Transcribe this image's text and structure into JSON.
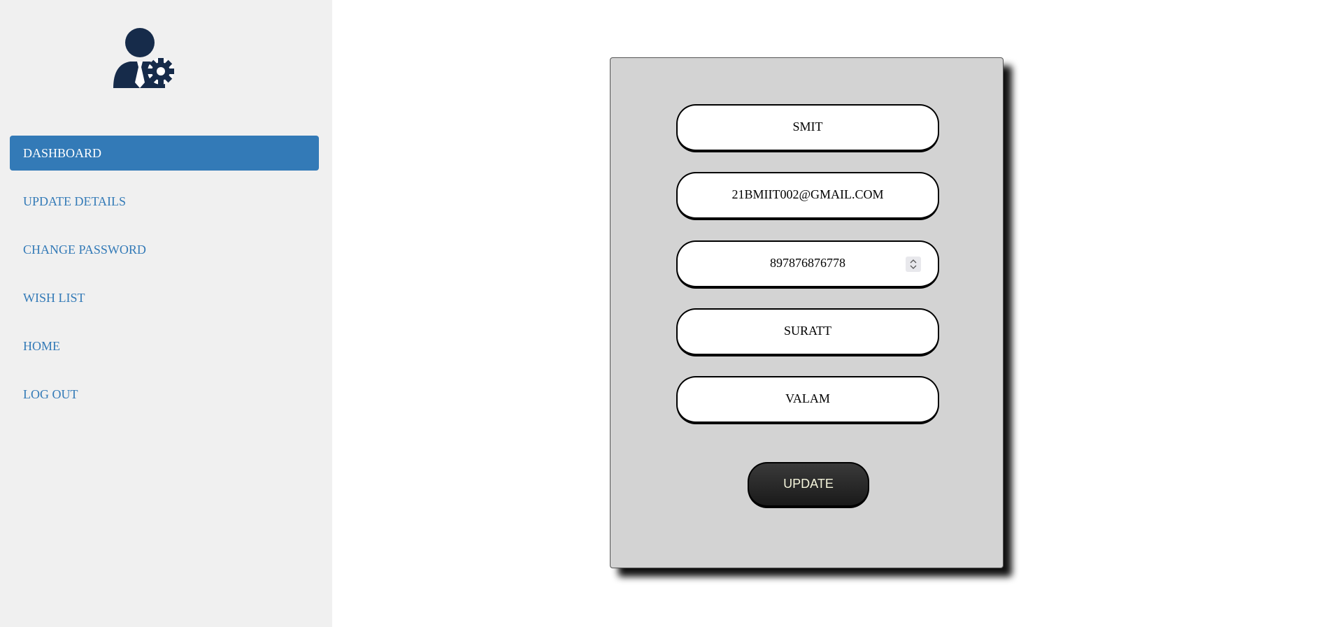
{
  "sidebar": {
    "logo_icon": "user-gear-icon",
    "accent_color": "#337ab7",
    "items": [
      {
        "label": "DASHBOARD",
        "active": true
      },
      {
        "label": "UPDATE DETAILS",
        "active": false
      },
      {
        "label": "CHANGE PASSWORD",
        "active": false
      },
      {
        "label": "WISH LIST",
        "active": false
      },
      {
        "label": "HOME",
        "active": false
      },
      {
        "label": "LOG OUT",
        "active": false
      }
    ]
  },
  "form": {
    "name_value": "SMIT",
    "email_value": "21BMIIT002@GMAIL.COM",
    "phone_value": "897876876778",
    "city_value": "SURATT",
    "area_value": "VALAM",
    "submit_label": "UPDATE"
  }
}
